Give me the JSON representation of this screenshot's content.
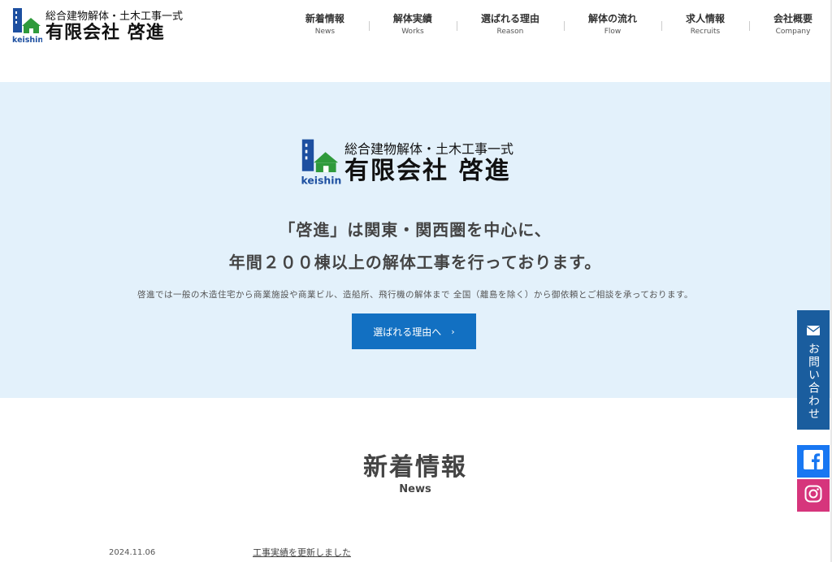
{
  "brand": {
    "tagline": "総合建物解体・土木工事一式",
    "name": "有限会社 啓進",
    "mark_text": "keishin",
    "colors": {
      "building": "#1d4fa0",
      "roof": "#2f9a3c"
    }
  },
  "nav": {
    "items": [
      {
        "ja": "新着情報",
        "en": "News"
      },
      {
        "ja": "解体実績",
        "en": "Works"
      },
      {
        "ja": "選ばれる理由",
        "en": "Reason"
      },
      {
        "ja": "解体の流れ",
        "en": "Flow"
      },
      {
        "ja": "求人情報",
        "en": "Recruits"
      },
      {
        "ja": "会社概要",
        "en": "Company"
      }
    ]
  },
  "hero": {
    "line1": "「啓進」は関東・関西圏を中心に、",
    "line2": "年間２００棟以上の解体工事を行っております。",
    "description": "啓進では一般の木造住宅から商業施設や商業ビル、造船所、飛行機の解体まで 全国（離島を除く）から御依頼とご相談を承っております。",
    "button_label": "選ばれる理由へ",
    "button_icon": "chevron-right-icon",
    "background": "#e3f1fb",
    "button_color": "#1270c2"
  },
  "news": {
    "title": "新着情報",
    "subtitle": "News",
    "items": [
      {
        "date": "2024.11.06",
        "text": "工事実績を更新しました"
      }
    ]
  },
  "side": {
    "contact_label": "お問い合わせ",
    "contact_icon": "mail-icon",
    "facebook_icon": "facebook-icon",
    "instagram_icon": "instagram-icon",
    "contact_color": "#1a5d9e",
    "facebook_color": "#1877f2",
    "instagram_color": "#d6357c"
  }
}
